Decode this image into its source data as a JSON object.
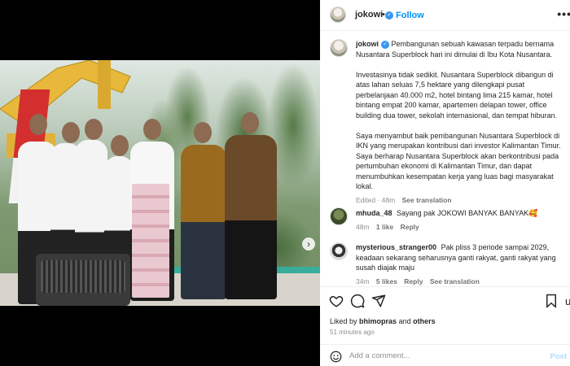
{
  "header": {
    "username": "jokowi",
    "follow_label": "Follow",
    "dot": "•",
    "more": "•••"
  },
  "caption": {
    "username": "jokowi",
    "paragraphs": [
      "Pembangunan sebuah kawasan terpadu bernama Nusantara Superblock hari ini dimulai di Ibu Kota Nusantara.",
      "Investasinya tidak sedikit. Nusantara Superblock dibangun di atas lahan seluas 7,5 hektare yang dilengkapi pusat perbelanjaan 40.000 m2, hotel bintang lima 215 kamar, hotel bintang empat 200 kamar, apartemen delapan tower, office building dua tower, sekolah internasional, dan tempat hiburan.",
      "Saya menyambut baik pembangunan Nusantara Superblock di IKN yang merupakan kontribusi dari investor Kalimantan Timur. Saya berharap Nusantara Superblock akan berkontribusi pada pertumbuhan ekonomi di Kalimantan Timur, dan dapat menumbuhkan kesempatan kerja yang luas bagi masyarakat lokal."
    ],
    "edited": "Edited · 48m",
    "see_translation": "See translation"
  },
  "comments": [
    {
      "username": "mhuda_48",
      "text": "Sayang pak JOKOWI BANYAK BANYAK🥰",
      "time": "48m",
      "likes": "1 like",
      "reply": "Reply"
    },
    {
      "username": "mysterious_stranger00",
      "text": "Pak pliss 3 periode sampai 2029, keadaan sekarang seharusnya ganti rakyat, ganti rakyat yang susah diajak maju",
      "time": "34m",
      "likes": "5 likes",
      "reply": "Reply",
      "see_translation": "See translation"
    }
  ],
  "likes": {
    "prefix": "Liked by",
    "user": "bhimopras",
    "and": "and",
    "others": "others"
  },
  "posted": "51 minutes ago",
  "add_comment": {
    "placeholder": "Add a comment...",
    "post_label": "Post"
  },
  "colors": {
    "link_blue": "#0095f6",
    "verified_blue": "#3797f0",
    "muted": "#8e8e8e"
  },
  "icons": [
    "heart-icon",
    "comment-icon",
    "share-icon",
    "bookmark-icon",
    "emoji-icon",
    "verified-icon",
    "next-arrow-icon"
  ]
}
